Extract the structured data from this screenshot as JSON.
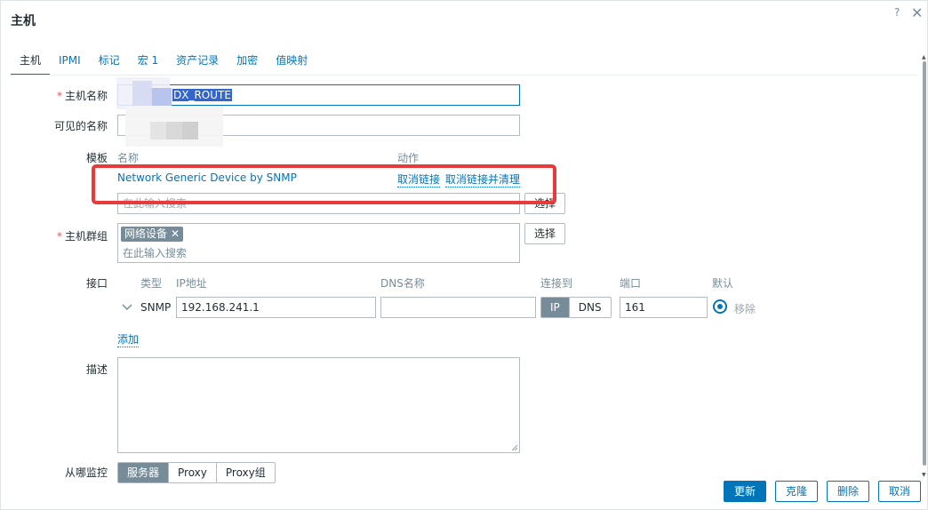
{
  "dialog": {
    "title": "主机",
    "help_label": "?",
    "close_label": "✕"
  },
  "tabs": [
    {
      "label": "主机"
    },
    {
      "label": "IPMI"
    },
    {
      "label": "标记"
    },
    {
      "label": "宏 1"
    },
    {
      "label": "资产记录"
    },
    {
      "label": "加密"
    },
    {
      "label": "值映射"
    }
  ],
  "host_name": {
    "label": "主机名称",
    "value_visible": "DX_ROUTE"
  },
  "visible_name": {
    "label": "可见的名称",
    "value": ""
  },
  "templates": {
    "label": "模板",
    "col_name": "名称",
    "col_action": "动作",
    "rows": [
      {
        "name": "Network Generic Device by SNMP",
        "unlink": "取消链接",
        "unlink_clear": "取消链接并清理"
      }
    ],
    "search_placeholder": "在此输入搜索",
    "select_button": "选择"
  },
  "host_groups": {
    "label": "主机群组",
    "chips": [
      "网络设备"
    ],
    "chip_remove": "✕",
    "placeholder": "在此输入搜索",
    "select_button": "选择"
  },
  "interfaces": {
    "label": "接口",
    "headers": {
      "type": "类型",
      "ip": "IP地址",
      "dns": "DNS名称",
      "connect": "连接到",
      "port": "端口",
      "default": "默认"
    },
    "rows": [
      {
        "type": "SNMP",
        "ip": "192.168.241.1",
        "dns": "",
        "connect_options": [
          "IP",
          "DNS"
        ],
        "connect_selected": "IP",
        "port": "161",
        "default": true,
        "remove": "移除"
      }
    ],
    "add_link": "添加"
  },
  "description": {
    "label": "描述",
    "value": ""
  },
  "monitored_by": {
    "label": "从哪监控",
    "options": [
      "服务器",
      "Proxy",
      "Proxy组"
    ],
    "selected": "服务器"
  },
  "footer": {
    "update": "更新",
    "clone": "克隆",
    "delete": "删除",
    "cancel": "取消"
  },
  "colors": {
    "accent": "#0275b8",
    "annotation_box": "#e83a3a",
    "required": "#e45959"
  }
}
